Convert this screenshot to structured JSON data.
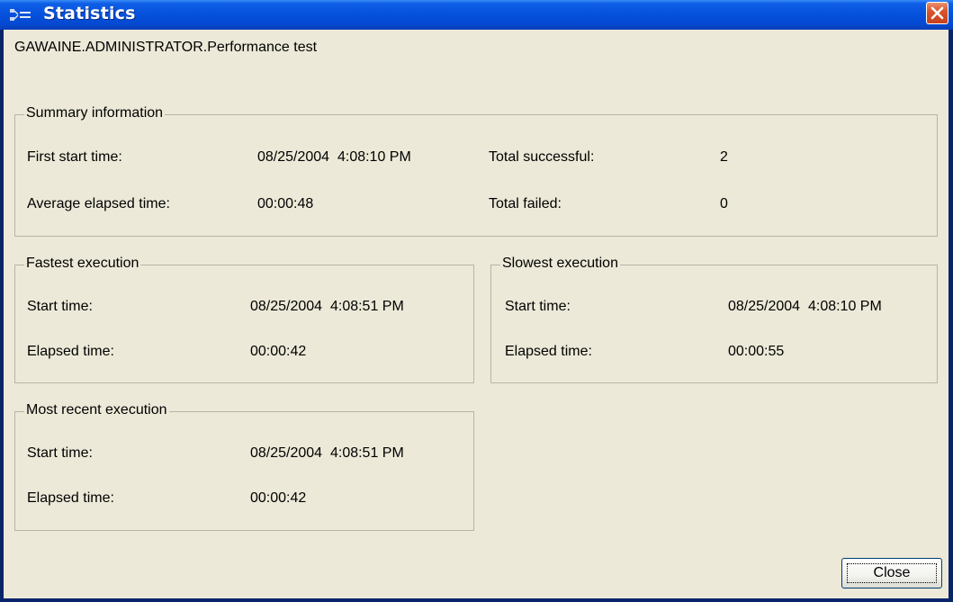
{
  "window": {
    "title": "Statistics",
    "close_glyph": "×"
  },
  "heading": "GAWAINE.ADMINISTRATOR.Performance test",
  "summary": {
    "legend": "Summary information",
    "first_start_label": "First start time:",
    "first_start_value": "08/25/2004  4:08:10 PM",
    "avg_elapsed_label": "Average elapsed time:",
    "avg_elapsed_value": "00:00:48",
    "total_successful_label": "Total successful:",
    "total_successful_value": "2",
    "total_failed_label": "Total failed:",
    "total_failed_value": "0"
  },
  "fastest": {
    "legend": "Fastest execution",
    "start_label": "Start time:",
    "start_value": "08/25/2004  4:08:51 PM",
    "elapsed_label": "Elapsed time:",
    "elapsed_value": "00:00:42"
  },
  "slowest": {
    "legend": "Slowest execution",
    "start_label": "Start time:",
    "start_value": "08/25/2004  4:08:10 PM",
    "elapsed_label": "Elapsed time:",
    "elapsed_value": "00:00:55"
  },
  "recent": {
    "legend": "Most recent execution",
    "start_label": "Start time:",
    "start_value": "08/25/2004  4:08:51 PM",
    "elapsed_label": "Elapsed time:",
    "elapsed_value": "00:00:42"
  },
  "buttons": {
    "close_label": "Close"
  },
  "colors": {
    "titlebar": "#0551dc",
    "client_bg": "#ece9d8",
    "close_red": "#d9562c"
  },
  "icons": {
    "title": "statistics-window-icon",
    "close": "close-icon"
  }
}
